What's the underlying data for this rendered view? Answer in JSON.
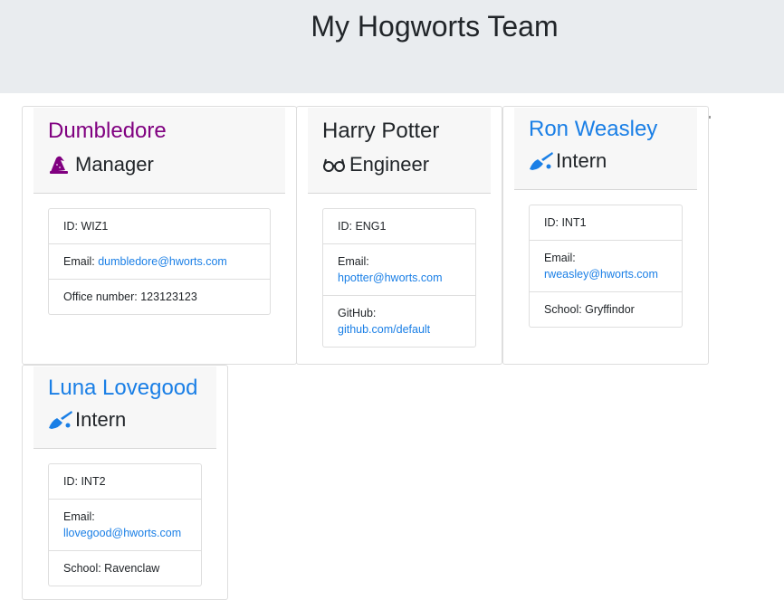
{
  "header": {
    "title": "My Hogworts Team"
  },
  "team": [
    {
      "name": "Dumbledore",
      "role": "Manager",
      "role_icon": "wizard-hat-icon",
      "id_label": "ID: WIZ1",
      "email_label": "Email: ",
      "email": "dumbledore@hworts.com",
      "extra_label": "Office number: 123123123"
    },
    {
      "name": "Harry Potter",
      "role": "Engineer",
      "role_icon": "glasses-icon",
      "id_label": "ID: ENG1",
      "email_label": "Email:",
      "email": "hpotter@hworts.com",
      "extra_label": "GitHub:",
      "extra_link": "github.com/default"
    },
    {
      "name": "Ron Weasley",
      "role": "Intern",
      "role_icon": "broom-icon",
      "id_label": "ID: INT1",
      "email_label": "Email:",
      "email": "rweasley@hworts.com",
      "extra_label": "School: Gryffindor"
    },
    {
      "name": "Luna Lovegood",
      "role": "Intern",
      "role_icon": "broom-icon",
      "id_label": "ID: INT2",
      "email_label": "Email:",
      "email": "llovegood@hworts.com",
      "extra_label": "School: Ravenclaw"
    }
  ],
  "colors": {
    "manager_name": "#800080",
    "intern_name": "#1a7fe6",
    "link": "#1a7fe6",
    "jumbotron_bg": "#e9ecef"
  }
}
